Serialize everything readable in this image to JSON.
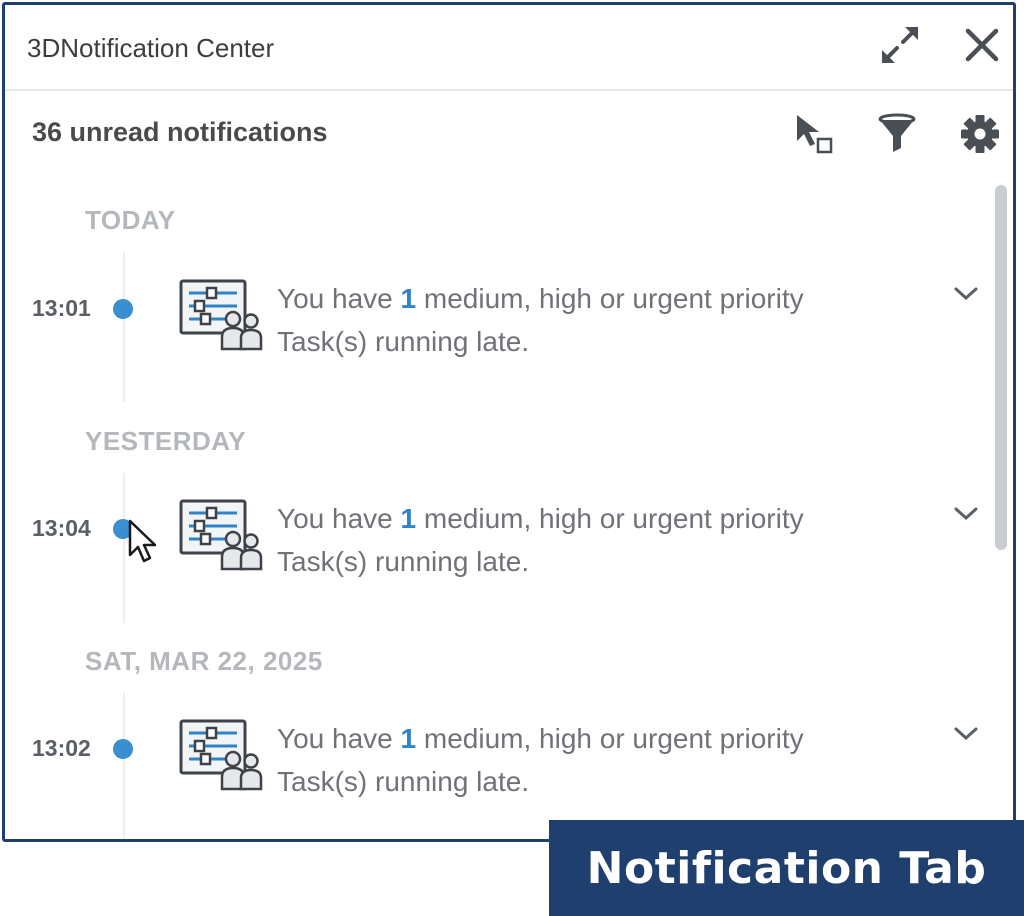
{
  "window": {
    "title": "3DNotification Center"
  },
  "titlebar_buttons": [
    {
      "name": "expand-button",
      "icon": "expand-arrows-icon"
    },
    {
      "name": "close-button",
      "icon": "close-icon"
    }
  ],
  "toolbar": {
    "unread_label": "36 unread notifications",
    "tools": [
      {
        "name": "select-mode-button",
        "icon": "select-cursor-icon"
      },
      {
        "name": "filter-button",
        "icon": "filter-funnel-icon"
      },
      {
        "name": "settings-button",
        "icon": "gear-icon"
      }
    ]
  },
  "groups": [
    {
      "title": "TODAY",
      "items": [
        {
          "time": "13:01",
          "msg_prefix": "You have ",
          "msg_count": "1",
          "msg_suffix": " medium, high or urgent priority Task(s) running late.",
          "icon": "task-management-icon"
        }
      ]
    },
    {
      "title": "YESTERDAY",
      "items": [
        {
          "time": "13:04",
          "msg_prefix": "You have ",
          "msg_count": "1",
          "msg_suffix": " medium, high or urgent priority Task(s) running late.",
          "icon": "task-management-icon"
        }
      ]
    },
    {
      "title": "SAT, MAR 22, 2025",
      "items": [
        {
          "time": "13:02",
          "msg_prefix": "You have ",
          "msg_count": "1",
          "msg_suffix": " medium, high or urgent priority Task(s) running late.",
          "icon": "task-management-icon"
        }
      ]
    }
  ],
  "caption": {
    "text": "Notification Tab"
  },
  "colors": {
    "frame": "#1f3f6e",
    "unread_dot": "#3a8fd0",
    "highlight_number": "#2f83c6",
    "group_title": "#b4b7bb"
  }
}
